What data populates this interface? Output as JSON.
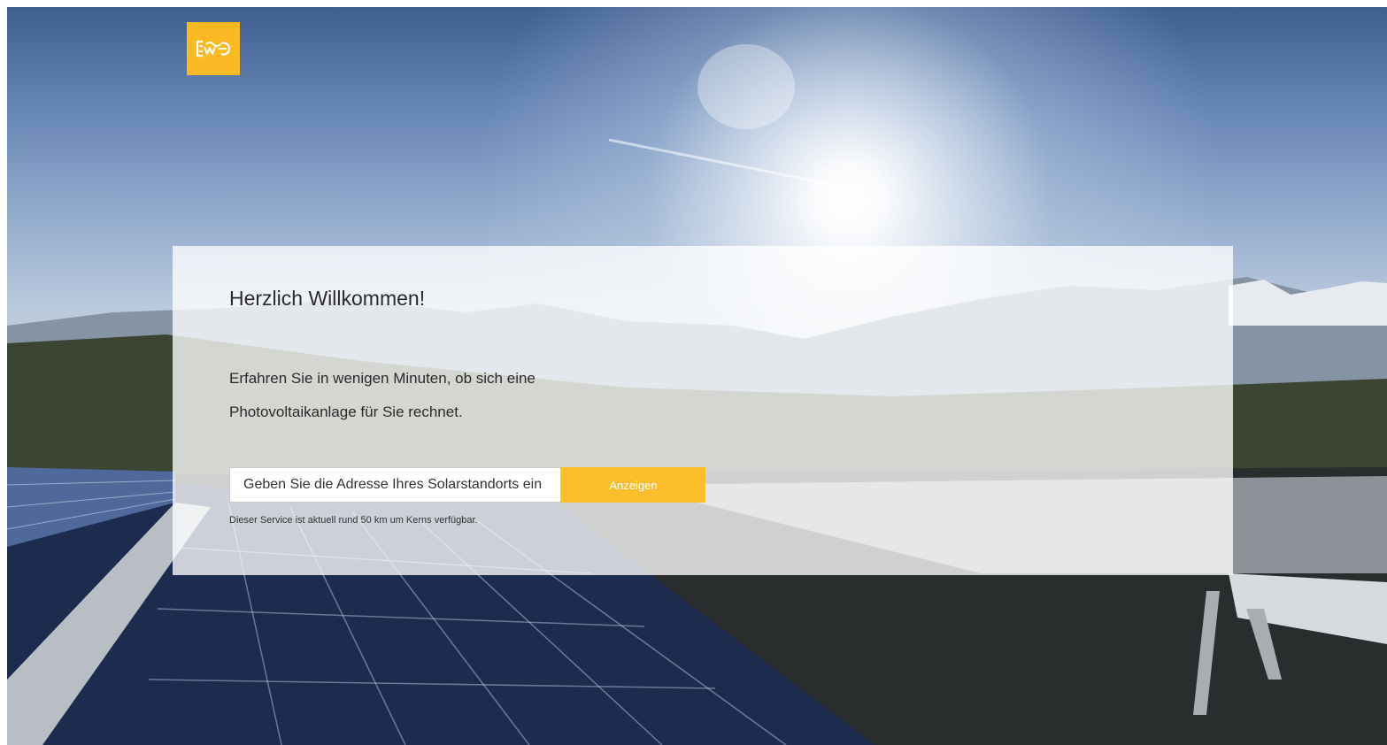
{
  "brand": {
    "logo_icon": "ewo-logo-icon",
    "accent_color": "#fbbd2a"
  },
  "welcome": {
    "title": "Herzlich Willkommen!",
    "intro": "Erfahren Sie in wenigen Minuten, ob sich eine Photovoltaikanlage für Sie rechnet."
  },
  "search": {
    "placeholder": "Geben Sie die Adresse Ihres Solarstandorts ein",
    "button_label": "Anzeigen"
  },
  "note": "Dieser Service ist aktuell rund 50 km um Kerns verfügbar."
}
